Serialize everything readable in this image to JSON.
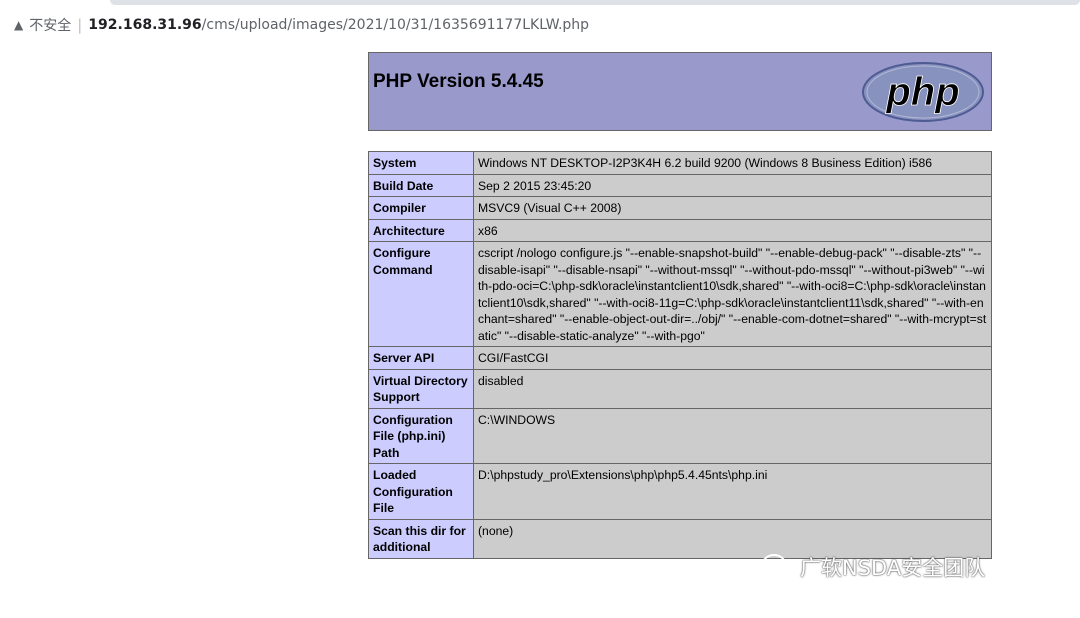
{
  "browser": {
    "security_icon": "warning-triangle-icon",
    "security_label": "不安全",
    "url_host": "192.168.31.96",
    "url_path": "/cms/upload/images/2021/10/31/1635691177LKLW.php"
  },
  "phpinfo": {
    "title": "PHP Version 5.4.45",
    "logo_text": "php",
    "rows": [
      {
        "key": "System",
        "value": "Windows NT DESKTOP-I2P3K4H 6.2 build 9200 (Windows 8 Business Edition) i586"
      },
      {
        "key": "Build Date",
        "value": "Sep 2 2015 23:45:20"
      },
      {
        "key": "Compiler",
        "value": "MSVC9 (Visual C++ 2008)"
      },
      {
        "key": "Architecture",
        "value": "x86"
      },
      {
        "key": "Configure Command",
        "value": "cscript /nologo configure.js \"--enable-snapshot-build\" \"--enable-debug-pack\" \"--disable-zts\" \"--disable-isapi\" \"--disable-nsapi\" \"--without-mssql\" \"--without-pdo-mssql\" \"--without-pi3web\" \"--with-pdo-oci=C:\\php-sdk\\oracle\\instantclient10\\sdk,shared\" \"--with-oci8=C:\\php-sdk\\oracle\\instantclient10\\sdk,shared\" \"--with-oci8-11g=C:\\php-sdk\\oracle\\instantclient11\\sdk,shared\" \"--with-enchant=shared\" \"--enable-object-out-dir=../obj/\" \"--enable-com-dotnet=shared\" \"--with-mcrypt=static\" \"--disable-static-analyze\" \"--with-pgo\""
      },
      {
        "key": "Server API",
        "value": "CGI/FastCGI"
      },
      {
        "key": "Virtual Directory Support",
        "value": "disabled"
      },
      {
        "key": "Configuration File (php.ini) Path",
        "value": "C:\\WINDOWS"
      },
      {
        "key": "Loaded Configuration File",
        "value": "D:\\phpstudy_pro\\Extensions\\php\\php5.4.45nts\\php.ini"
      },
      {
        "key": "Scan this dir for additional",
        "value": "(none)"
      }
    ]
  },
  "watermark": {
    "icon": "wechat-icon",
    "text": "广软NSDA安全团队"
  }
}
